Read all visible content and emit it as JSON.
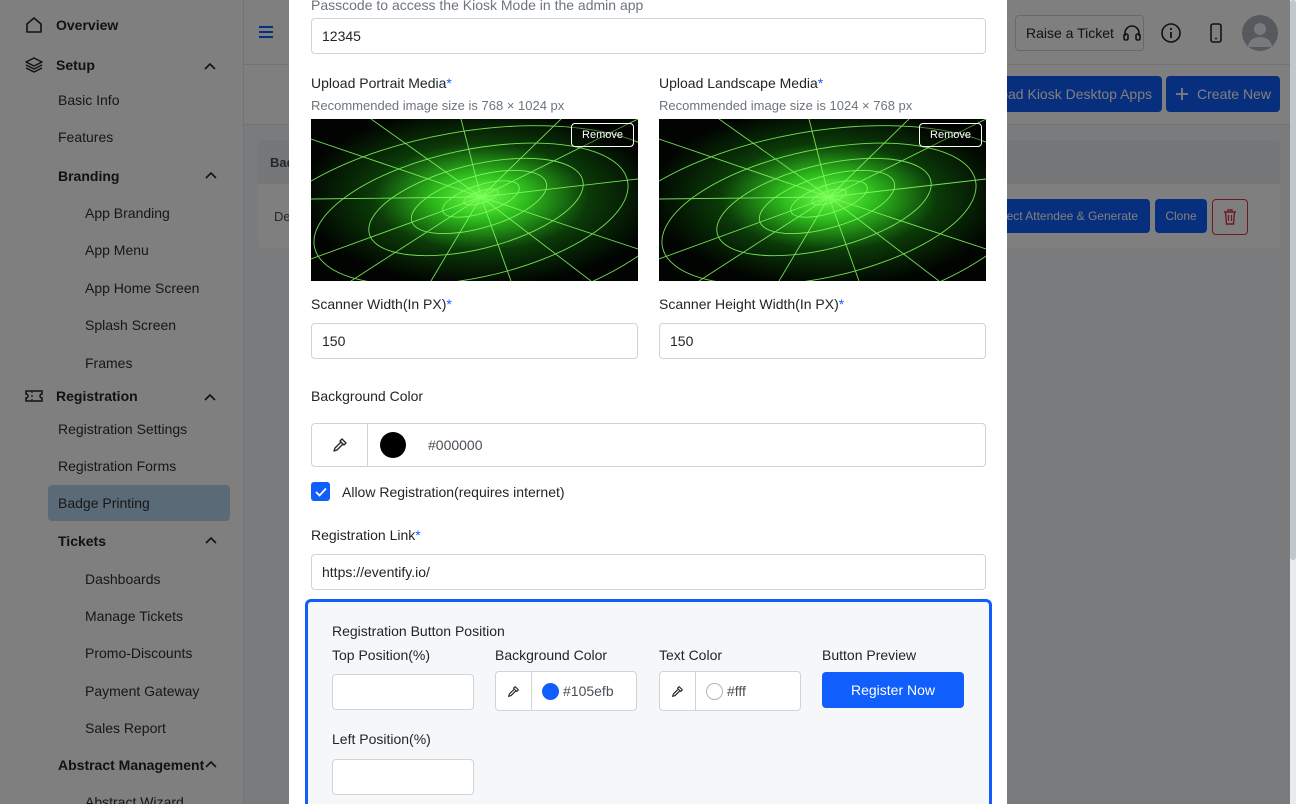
{
  "sidebar": {
    "overview": "Overview",
    "setup": "Setup",
    "basic_info": "Basic Info",
    "features": "Features",
    "branding": "Branding",
    "app_branding": "App Branding",
    "app_menu": "App Menu",
    "app_home_screen": "App Home Screen",
    "splash_screen": "Splash Screen",
    "frames": "Frames",
    "registration": "Registration",
    "registration_settings": "Registration Settings",
    "registration_forms": "Registration Forms",
    "badge_printing": "Badge Printing",
    "tickets": "Tickets",
    "dashboards": "Dashboards",
    "manage_tickets": "Manage Tickets",
    "promo_discounts": "Promo-Discounts",
    "payment_gateway": "Payment Gateway",
    "sales_report": "Sales Report",
    "abstract_management": "Abstract Management",
    "abstract_wizard": "Abstract Wizard"
  },
  "topbar": {
    "raise_ticket": "Raise a Ticket"
  },
  "page": {
    "download_label": "oad Kiosk Desktop Apps",
    "create_new": "Create New",
    "table_header": "Bad",
    "row_text": "De",
    "select_generate": "elect Attendee & Generate",
    "clone": "Clone"
  },
  "modal": {
    "passcode_hint": "Passcode to access the Kiosk Mode in the admin app",
    "passcode_value": "12345",
    "portrait_label": "Upload Portrait Media",
    "portrait_hint": "Recommended image size is 768 × 1024 px",
    "landscape_label": "Upload Landscape Media",
    "landscape_hint": "Recommended image size is 1024 × 768 px",
    "remove": "Remove",
    "scanner_width_label": "Scanner Width(In PX)",
    "scanner_width_value": "150",
    "scanner_height_label": "Scanner Height Width(In PX)",
    "scanner_height_value": "150",
    "background_color_label": "Background Color",
    "background_color_value": "#000000",
    "allow_registration": "Allow Registration(requires internet)",
    "registration_link_label": "Registration Link",
    "registration_link_value": "https://eventify.io/",
    "required_mark": "*",
    "button_position": {
      "title": "Registration Button Position",
      "top_label": "Top Position(%)",
      "top_value": "",
      "left_label": "Left Position(%)",
      "left_value": "",
      "bg_label": "Background Color",
      "bg_value": "#105efb",
      "text_label": "Text Color",
      "text_value": "#fff",
      "preview_label": "Button Preview",
      "preview_button": "Register Now"
    }
  },
  "colors": {
    "primary": "#105efb",
    "active_nav": "#b6d4ee",
    "danger": "#dc3545"
  }
}
